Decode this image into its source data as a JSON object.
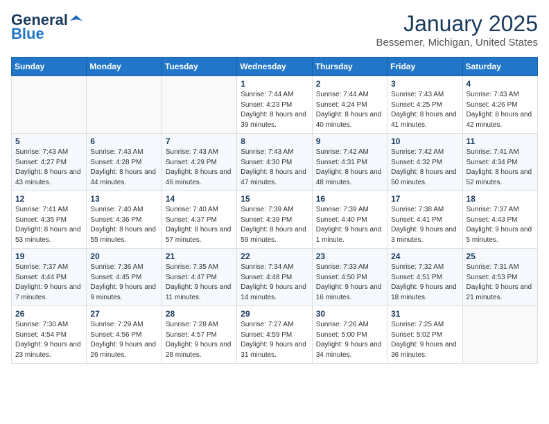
{
  "header": {
    "logo_general": "General",
    "logo_blue": "Blue",
    "month_title": "January 2025",
    "location": "Bessemer, Michigan, United States"
  },
  "weekdays": [
    "Sunday",
    "Monday",
    "Tuesday",
    "Wednesday",
    "Thursday",
    "Friday",
    "Saturday"
  ],
  "weeks": [
    [
      {
        "day": "",
        "content": ""
      },
      {
        "day": "",
        "content": ""
      },
      {
        "day": "",
        "content": ""
      },
      {
        "day": "1",
        "content": "Sunrise: 7:44 AM\nSunset: 4:23 PM\nDaylight: 8 hours and 39 minutes."
      },
      {
        "day": "2",
        "content": "Sunrise: 7:44 AM\nSunset: 4:24 PM\nDaylight: 8 hours and 40 minutes."
      },
      {
        "day": "3",
        "content": "Sunrise: 7:43 AM\nSunset: 4:25 PM\nDaylight: 8 hours and 41 minutes."
      },
      {
        "day": "4",
        "content": "Sunrise: 7:43 AM\nSunset: 4:26 PM\nDaylight: 8 hours and 42 minutes."
      }
    ],
    [
      {
        "day": "5",
        "content": "Sunrise: 7:43 AM\nSunset: 4:27 PM\nDaylight: 8 hours and 43 minutes."
      },
      {
        "day": "6",
        "content": "Sunrise: 7:43 AM\nSunset: 4:28 PM\nDaylight: 8 hours and 44 minutes."
      },
      {
        "day": "7",
        "content": "Sunrise: 7:43 AM\nSunset: 4:29 PM\nDaylight: 8 hours and 46 minutes."
      },
      {
        "day": "8",
        "content": "Sunrise: 7:43 AM\nSunset: 4:30 PM\nDaylight: 8 hours and 47 minutes."
      },
      {
        "day": "9",
        "content": "Sunrise: 7:42 AM\nSunset: 4:31 PM\nDaylight: 8 hours and 48 minutes."
      },
      {
        "day": "10",
        "content": "Sunrise: 7:42 AM\nSunset: 4:32 PM\nDaylight: 8 hours and 50 minutes."
      },
      {
        "day": "11",
        "content": "Sunrise: 7:41 AM\nSunset: 4:34 PM\nDaylight: 8 hours and 52 minutes."
      }
    ],
    [
      {
        "day": "12",
        "content": "Sunrise: 7:41 AM\nSunset: 4:35 PM\nDaylight: 8 hours and 53 minutes."
      },
      {
        "day": "13",
        "content": "Sunrise: 7:40 AM\nSunset: 4:36 PM\nDaylight: 8 hours and 55 minutes."
      },
      {
        "day": "14",
        "content": "Sunrise: 7:40 AM\nSunset: 4:37 PM\nDaylight: 8 hours and 57 minutes."
      },
      {
        "day": "15",
        "content": "Sunrise: 7:39 AM\nSunset: 4:39 PM\nDaylight: 8 hours and 59 minutes."
      },
      {
        "day": "16",
        "content": "Sunrise: 7:39 AM\nSunset: 4:40 PM\nDaylight: 9 hours and 1 minute."
      },
      {
        "day": "17",
        "content": "Sunrise: 7:38 AM\nSunset: 4:41 PM\nDaylight: 9 hours and 3 minutes."
      },
      {
        "day": "18",
        "content": "Sunrise: 7:37 AM\nSunset: 4:43 PM\nDaylight: 9 hours and 5 minutes."
      }
    ],
    [
      {
        "day": "19",
        "content": "Sunrise: 7:37 AM\nSunset: 4:44 PM\nDaylight: 9 hours and 7 minutes."
      },
      {
        "day": "20",
        "content": "Sunrise: 7:36 AM\nSunset: 4:45 PM\nDaylight: 9 hours and 9 minutes."
      },
      {
        "day": "21",
        "content": "Sunrise: 7:35 AM\nSunset: 4:47 PM\nDaylight: 9 hours and 11 minutes."
      },
      {
        "day": "22",
        "content": "Sunrise: 7:34 AM\nSunset: 4:48 PM\nDaylight: 9 hours and 14 minutes."
      },
      {
        "day": "23",
        "content": "Sunrise: 7:33 AM\nSunset: 4:50 PM\nDaylight: 9 hours and 16 minutes."
      },
      {
        "day": "24",
        "content": "Sunrise: 7:32 AM\nSunset: 4:51 PM\nDaylight: 9 hours and 18 minutes."
      },
      {
        "day": "25",
        "content": "Sunrise: 7:31 AM\nSunset: 4:53 PM\nDaylight: 9 hours and 21 minutes."
      }
    ],
    [
      {
        "day": "26",
        "content": "Sunrise: 7:30 AM\nSunset: 4:54 PM\nDaylight: 9 hours and 23 minutes."
      },
      {
        "day": "27",
        "content": "Sunrise: 7:29 AM\nSunset: 4:56 PM\nDaylight: 9 hours and 26 minutes."
      },
      {
        "day": "28",
        "content": "Sunrise: 7:28 AM\nSunset: 4:57 PM\nDaylight: 9 hours and 28 minutes."
      },
      {
        "day": "29",
        "content": "Sunrise: 7:27 AM\nSunset: 4:59 PM\nDaylight: 9 hours and 31 minutes."
      },
      {
        "day": "30",
        "content": "Sunrise: 7:26 AM\nSunset: 5:00 PM\nDaylight: 9 hours and 34 minutes."
      },
      {
        "day": "31",
        "content": "Sunrise: 7:25 AM\nSunset: 5:02 PM\nDaylight: 9 hours and 36 minutes."
      },
      {
        "day": "",
        "content": ""
      }
    ]
  ]
}
